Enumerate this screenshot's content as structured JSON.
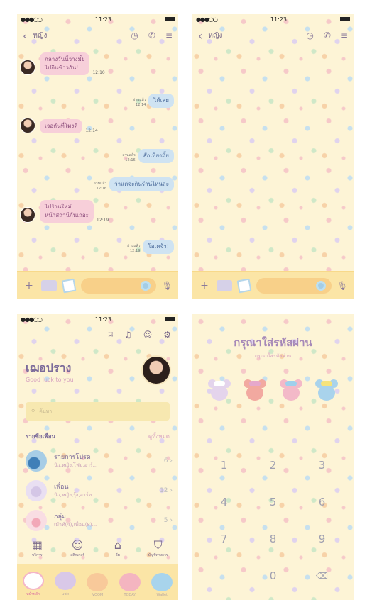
{
  "status": {
    "time": "11:23",
    "signal": "●●●○○"
  },
  "chat": {
    "title": "หญิง",
    "messages": [
      {
        "dir": "in",
        "text_lines": [
          "กลางวันนี้ว่างมั้ย",
          "ไปกินข้าวกัน!"
        ],
        "time": "12:10"
      },
      {
        "dir": "out",
        "text_lines": [
          "ได้เลย"
        ],
        "read": "อ่านแล้ว",
        "time": "12:14"
      },
      {
        "dir": "in",
        "text_lines": [
          "เจอกันที่โมงดี"
        ],
        "time": "12:14"
      },
      {
        "dir": "out",
        "text_lines": [
          "สักเที่ยงมั้ย"
        ],
        "read": "อ่านแล้ว",
        "time": "12:16"
      },
      {
        "dir": "out",
        "text_lines": [
          "ว่าแต่จะกินร้านไหนล่ะ"
        ],
        "read": "อ่านแล้ว",
        "time": "12:16"
      },
      {
        "dir": "in",
        "text_lines": [
          "ไปร้านใหม่",
          "หน้าสถานีกันเถอะ"
        ],
        "time": "12:19"
      },
      {
        "dir": "out",
        "text_lines": [
          "โอเคจ้า!"
        ],
        "read": "อ่านแล้ว",
        "time": "12:19"
      }
    ]
  },
  "profile": {
    "name": "เฌอปราง",
    "status_message": "Good luck to you",
    "search_placeholder": "ค้นหา",
    "friends_header": "รายชื่อเพื่อน",
    "see_all": "ดูทั้งหมด",
    "list": [
      {
        "name": "รายการโปรด",
        "desc": "นิว,หญิง,โฟม,อาร์...",
        "count": "6"
      },
      {
        "name": "เพื่อน",
        "desc": "นิว,หญิง,รุ้ง,อาร์ท...",
        "count": "12"
      },
      {
        "name": "กลุ่ม",
        "desc": "เม้าท์(4),เพื่อน(8)...",
        "count": "5"
      }
    ],
    "quick": [
      {
        "label": "บริการ",
        "icon": "grid-icon"
      },
      {
        "label": "สติกเกอร์",
        "icon": "smiley-icon"
      },
      {
        "label": "ธีม",
        "icon": "brush-icon"
      },
      {
        "label": "บัญชีทางการ",
        "icon": "badge-icon"
      }
    ],
    "tabs": [
      {
        "label": "หน้าหลัก",
        "color": "#ffffff"
      },
      {
        "label": "แชท",
        "color": "#d9c8e8"
      },
      {
        "label": "VOOM",
        "color": "#f8c99a"
      },
      {
        "label": "TODAY",
        "color": "#f4b5c0"
      },
      {
        "label": "Wallet",
        "color": "#a8d4ec"
      }
    ]
  },
  "passcode": {
    "title": "กรุณาใส่รหัสผ่าน",
    "subtitle": "กรุณาใส่รหัสผ่าน",
    "slots": [
      {
        "face": "#e4d4ec",
        "bow": "#ffffff"
      },
      {
        "face": "#f2a9a0",
        "bow": "#e6a8cc"
      },
      {
        "face": "#f3b9c8",
        "bow": "#9fd0ec"
      },
      {
        "face": "#a9d3ec",
        "bow": "#f5e37c"
      }
    ],
    "keys": [
      "1",
      "2",
      "3",
      "4",
      "5",
      "6",
      "7",
      "8",
      "9",
      "",
      "0",
      "⌫"
    ]
  }
}
